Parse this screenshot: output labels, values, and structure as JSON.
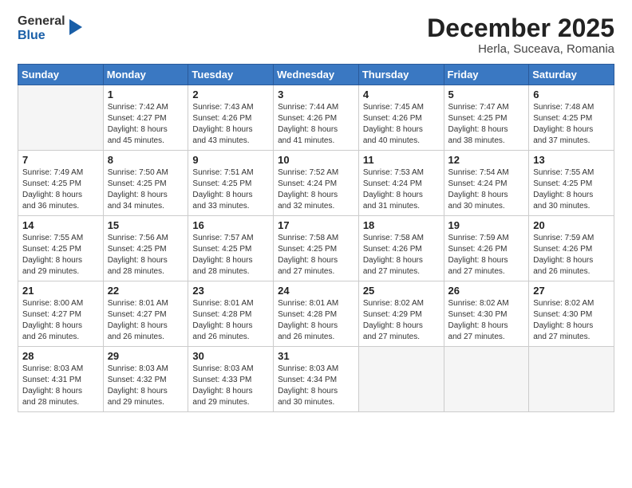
{
  "header": {
    "logo_line1": "General",
    "logo_line2": "Blue",
    "month": "December 2025",
    "location": "Herla, Suceava, Romania"
  },
  "weekdays": [
    "Sunday",
    "Monday",
    "Tuesday",
    "Wednesday",
    "Thursday",
    "Friday",
    "Saturday"
  ],
  "weeks": [
    [
      {
        "num": "",
        "info": ""
      },
      {
        "num": "1",
        "info": "Sunrise: 7:42 AM\nSunset: 4:27 PM\nDaylight: 8 hours\nand 45 minutes."
      },
      {
        "num": "2",
        "info": "Sunrise: 7:43 AM\nSunset: 4:26 PM\nDaylight: 8 hours\nand 43 minutes."
      },
      {
        "num": "3",
        "info": "Sunrise: 7:44 AM\nSunset: 4:26 PM\nDaylight: 8 hours\nand 41 minutes."
      },
      {
        "num": "4",
        "info": "Sunrise: 7:45 AM\nSunset: 4:26 PM\nDaylight: 8 hours\nand 40 minutes."
      },
      {
        "num": "5",
        "info": "Sunrise: 7:47 AM\nSunset: 4:25 PM\nDaylight: 8 hours\nand 38 minutes."
      },
      {
        "num": "6",
        "info": "Sunrise: 7:48 AM\nSunset: 4:25 PM\nDaylight: 8 hours\nand 37 minutes."
      }
    ],
    [
      {
        "num": "7",
        "info": "Sunrise: 7:49 AM\nSunset: 4:25 PM\nDaylight: 8 hours\nand 36 minutes."
      },
      {
        "num": "8",
        "info": "Sunrise: 7:50 AM\nSunset: 4:25 PM\nDaylight: 8 hours\nand 34 minutes."
      },
      {
        "num": "9",
        "info": "Sunrise: 7:51 AM\nSunset: 4:25 PM\nDaylight: 8 hours\nand 33 minutes."
      },
      {
        "num": "10",
        "info": "Sunrise: 7:52 AM\nSunset: 4:24 PM\nDaylight: 8 hours\nand 32 minutes."
      },
      {
        "num": "11",
        "info": "Sunrise: 7:53 AM\nSunset: 4:24 PM\nDaylight: 8 hours\nand 31 minutes."
      },
      {
        "num": "12",
        "info": "Sunrise: 7:54 AM\nSunset: 4:24 PM\nDaylight: 8 hours\nand 30 minutes."
      },
      {
        "num": "13",
        "info": "Sunrise: 7:55 AM\nSunset: 4:25 PM\nDaylight: 8 hours\nand 30 minutes."
      }
    ],
    [
      {
        "num": "14",
        "info": "Sunrise: 7:55 AM\nSunset: 4:25 PM\nDaylight: 8 hours\nand 29 minutes."
      },
      {
        "num": "15",
        "info": "Sunrise: 7:56 AM\nSunset: 4:25 PM\nDaylight: 8 hours\nand 28 minutes."
      },
      {
        "num": "16",
        "info": "Sunrise: 7:57 AM\nSunset: 4:25 PM\nDaylight: 8 hours\nand 28 minutes."
      },
      {
        "num": "17",
        "info": "Sunrise: 7:58 AM\nSunset: 4:25 PM\nDaylight: 8 hours\nand 27 minutes."
      },
      {
        "num": "18",
        "info": "Sunrise: 7:58 AM\nSunset: 4:26 PM\nDaylight: 8 hours\nand 27 minutes."
      },
      {
        "num": "19",
        "info": "Sunrise: 7:59 AM\nSunset: 4:26 PM\nDaylight: 8 hours\nand 27 minutes."
      },
      {
        "num": "20",
        "info": "Sunrise: 7:59 AM\nSunset: 4:26 PM\nDaylight: 8 hours\nand 26 minutes."
      }
    ],
    [
      {
        "num": "21",
        "info": "Sunrise: 8:00 AM\nSunset: 4:27 PM\nDaylight: 8 hours\nand 26 minutes."
      },
      {
        "num": "22",
        "info": "Sunrise: 8:01 AM\nSunset: 4:27 PM\nDaylight: 8 hours\nand 26 minutes."
      },
      {
        "num": "23",
        "info": "Sunrise: 8:01 AM\nSunset: 4:28 PM\nDaylight: 8 hours\nand 26 minutes."
      },
      {
        "num": "24",
        "info": "Sunrise: 8:01 AM\nSunset: 4:28 PM\nDaylight: 8 hours\nand 26 minutes."
      },
      {
        "num": "25",
        "info": "Sunrise: 8:02 AM\nSunset: 4:29 PM\nDaylight: 8 hours\nand 27 minutes."
      },
      {
        "num": "26",
        "info": "Sunrise: 8:02 AM\nSunset: 4:30 PM\nDaylight: 8 hours\nand 27 minutes."
      },
      {
        "num": "27",
        "info": "Sunrise: 8:02 AM\nSunset: 4:30 PM\nDaylight: 8 hours\nand 27 minutes."
      }
    ],
    [
      {
        "num": "28",
        "info": "Sunrise: 8:03 AM\nSunset: 4:31 PM\nDaylight: 8 hours\nand 28 minutes."
      },
      {
        "num": "29",
        "info": "Sunrise: 8:03 AM\nSunset: 4:32 PM\nDaylight: 8 hours\nand 29 minutes."
      },
      {
        "num": "30",
        "info": "Sunrise: 8:03 AM\nSunset: 4:33 PM\nDaylight: 8 hours\nand 29 minutes."
      },
      {
        "num": "31",
        "info": "Sunrise: 8:03 AM\nSunset: 4:34 PM\nDaylight: 8 hours\nand 30 minutes."
      },
      {
        "num": "",
        "info": ""
      },
      {
        "num": "",
        "info": ""
      },
      {
        "num": "",
        "info": ""
      }
    ]
  ]
}
